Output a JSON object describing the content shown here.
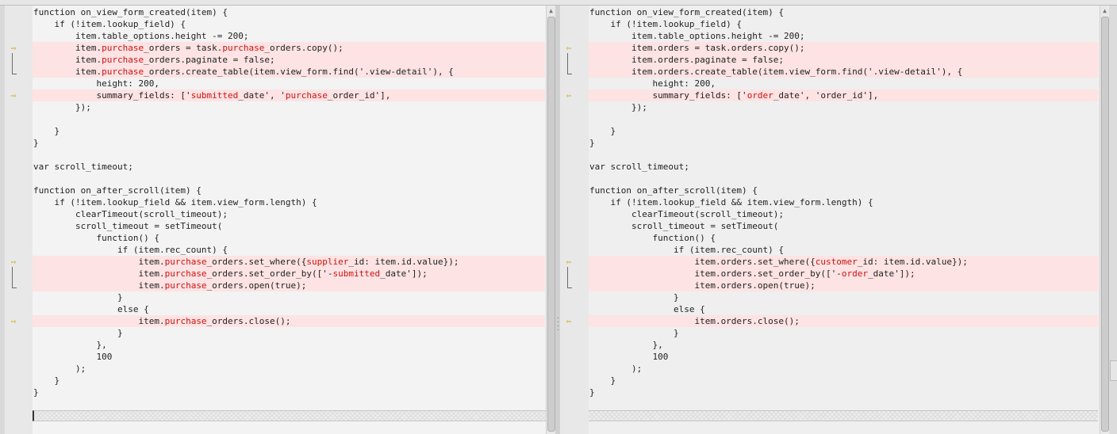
{
  "left_lines": [
    [
      {
        "t": "function on_view_form_created(item) {"
      }
    ],
    [
      {
        "t": "    if (!item.lookup_field) {"
      }
    ],
    [
      {
        "t": "        item.table_options.height -= 200;"
      }
    ],
    [
      {
        "t": "        item."
      },
      {
        "t": "purchase",
        "h": true
      },
      {
        "t": "_orders = task."
      },
      {
        "t": "purchase",
        "h": true
      },
      {
        "t": "_orders.copy();"
      }
    ],
    [
      {
        "t": "        item."
      },
      {
        "t": "purchase",
        "h": true
      },
      {
        "t": "_orders.paginate = false;"
      }
    ],
    [
      {
        "t": "        item."
      },
      {
        "t": "purchase",
        "h": true
      },
      {
        "t": "_orders.create_table(item.view_form.find('.view-detail'), {"
      }
    ],
    [
      {
        "t": "            height: 200,"
      }
    ],
    [
      {
        "t": "            summary_fields: ['"
      },
      {
        "t": "submitted",
        "h": true
      },
      {
        "t": "_date', '"
      },
      {
        "t": "purchase",
        "h": true
      },
      {
        "t": "_order_id'],"
      }
    ],
    [
      {
        "t": "        });"
      }
    ],
    [
      {
        "t": ""
      }
    ],
    [
      {
        "t": "    }"
      }
    ],
    [
      {
        "t": "}"
      }
    ],
    [
      {
        "t": ""
      }
    ],
    [
      {
        "t": "var scroll_timeout;"
      }
    ],
    [
      {
        "t": ""
      }
    ],
    [
      {
        "t": "function on_after_scroll(item) {"
      }
    ],
    [
      {
        "t": "    if (!item.lookup_field && item.view_form.length) {"
      }
    ],
    [
      {
        "t": "        clearTimeout(scroll_timeout);"
      }
    ],
    [
      {
        "t": "        scroll_timeout = setTimeout("
      }
    ],
    [
      {
        "t": "            function() {"
      }
    ],
    [
      {
        "t": "                if (item.rec_count) {"
      }
    ],
    [
      {
        "t": "                    item."
      },
      {
        "t": "purchase",
        "h": true
      },
      {
        "t": "_orders.set_where({"
      },
      {
        "t": "supplier",
        "h": true
      },
      {
        "t": "_id: item.id.value});"
      }
    ],
    [
      {
        "t": "                    item."
      },
      {
        "t": "purchase",
        "h": true
      },
      {
        "t": "_orders.set_order_by(['-"
      },
      {
        "t": "submitted",
        "h": true
      },
      {
        "t": "_date']);"
      }
    ],
    [
      {
        "t": "                    item."
      },
      {
        "t": "purchase",
        "h": true
      },
      {
        "t": "_orders.open(true);"
      }
    ],
    [
      {
        "t": "                }"
      }
    ],
    [
      {
        "t": "                else {"
      }
    ],
    [
      {
        "t": "                    item."
      },
      {
        "t": "purchase",
        "h": true
      },
      {
        "t": "_orders.close();"
      }
    ],
    [
      {
        "t": "                }"
      }
    ],
    [
      {
        "t": "            },"
      }
    ],
    [
      {
        "t": "            100"
      }
    ],
    [
      {
        "t": "        );"
      }
    ],
    [
      {
        "t": "    }"
      }
    ],
    [
      {
        "t": "}"
      }
    ]
  ],
  "right_lines": [
    [
      {
        "t": "function on_view_form_created(item) {"
      }
    ],
    [
      {
        "t": "    if (!item.lookup_field) {"
      }
    ],
    [
      {
        "t": "        item.table_options.height -= 200;"
      }
    ],
    [
      {
        "t": "        item.orders = task.orders.copy();"
      }
    ],
    [
      {
        "t": "        item.orders.paginate = false;"
      }
    ],
    [
      {
        "t": "        item.orders.create_table(item.view_form.find('.view-detail'), {"
      }
    ],
    [
      {
        "t": "            height: 200,"
      }
    ],
    [
      {
        "t": "            summary_fields: ['"
      },
      {
        "t": "order",
        "h": true
      },
      {
        "t": "_date', 'order_id'],"
      }
    ],
    [
      {
        "t": "        });"
      }
    ],
    [
      {
        "t": ""
      }
    ],
    [
      {
        "t": "    }"
      }
    ],
    [
      {
        "t": "}"
      }
    ],
    [
      {
        "t": ""
      }
    ],
    [
      {
        "t": "var scroll_timeout;"
      }
    ],
    [
      {
        "t": ""
      }
    ],
    [
      {
        "t": "function on_after_scroll(item) {"
      }
    ],
    [
      {
        "t": "    if (!item.lookup_field && item.view_form.length) {"
      }
    ],
    [
      {
        "t": "        clearTimeout(scroll_timeout);"
      }
    ],
    [
      {
        "t": "        scroll_timeout = setTimeout("
      }
    ],
    [
      {
        "t": "            function() {"
      }
    ],
    [
      {
        "t": "                if (item.rec_count) {"
      }
    ],
    [
      {
        "t": "                    item.orders.set_where({"
      },
      {
        "t": "customer",
        "h": true
      },
      {
        "t": "_id: item.id.value});"
      }
    ],
    [
      {
        "t": "                    item.orders.set_order_by(['-"
      },
      {
        "t": "order",
        "h": true
      },
      {
        "t": "_date']);"
      }
    ],
    [
      {
        "t": "                    item.orders.open(true);"
      }
    ],
    [
      {
        "t": "                }"
      }
    ],
    [
      {
        "t": "                else {"
      }
    ],
    [
      {
        "t": "                    item.orders.close();"
      }
    ],
    [
      {
        "t": "                }"
      }
    ],
    [
      {
        "t": "            },"
      }
    ],
    [
      {
        "t": "            100"
      }
    ],
    [
      {
        "t": "        );"
      }
    ],
    [
      {
        "t": "    }"
      }
    ],
    [
      {
        "t": "}"
      }
    ]
  ],
  "diff_lines": [
    3,
    4,
    5,
    7,
    21,
    22,
    23,
    26
  ],
  "change_markers": [
    3,
    7,
    21,
    26
  ],
  "icons": {
    "left_marker": "⇨",
    "right_marker": "⇦",
    "scroll_up": "▲"
  },
  "colors": {
    "diff_background": "#fde3e3",
    "changed_text": "#d01010",
    "marker": "#c8a000"
  }
}
